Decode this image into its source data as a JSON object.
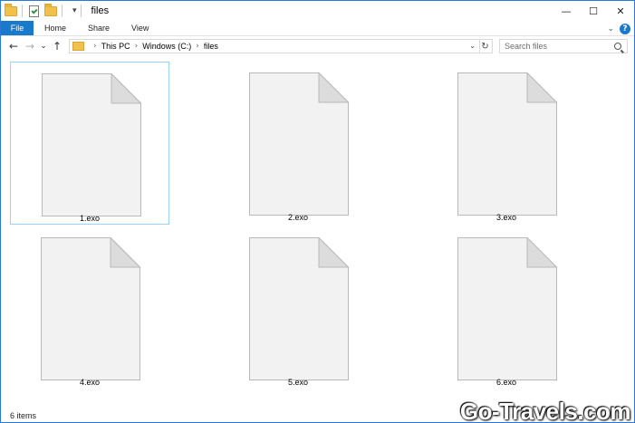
{
  "window": {
    "title": "files",
    "quick_access_dropdown": "▾",
    "controls": {
      "minimize": "—",
      "maximize": "☐",
      "close": "✕"
    }
  },
  "ribbon": {
    "tabs": [
      "File",
      "Home",
      "Share",
      "View"
    ],
    "expand_glyph": "⌄",
    "help_glyph": "?"
  },
  "nav": {
    "back": "←",
    "forward": "→",
    "recent": "⌄",
    "up": "↑"
  },
  "address": {
    "crumbs": [
      "This PC",
      "Windows (C:)",
      "files"
    ],
    "separator": "›",
    "dropdown": "⌄",
    "refresh": "↻"
  },
  "search": {
    "placeholder": "Search files"
  },
  "files": [
    {
      "name": "1.exo",
      "selected": true
    },
    {
      "name": "2.exo",
      "selected": false
    },
    {
      "name": "3.exo",
      "selected": false
    },
    {
      "name": "4.exo",
      "selected": false
    },
    {
      "name": "5.exo",
      "selected": false
    },
    {
      "name": "6.exo",
      "selected": false
    }
  ],
  "status": {
    "item_count": "6 items"
  },
  "watermark": "Go-Travels.com",
  "colors": {
    "accent": "#1979ca",
    "selection_border": "#99d1ff",
    "folder": "#f0c14b"
  }
}
